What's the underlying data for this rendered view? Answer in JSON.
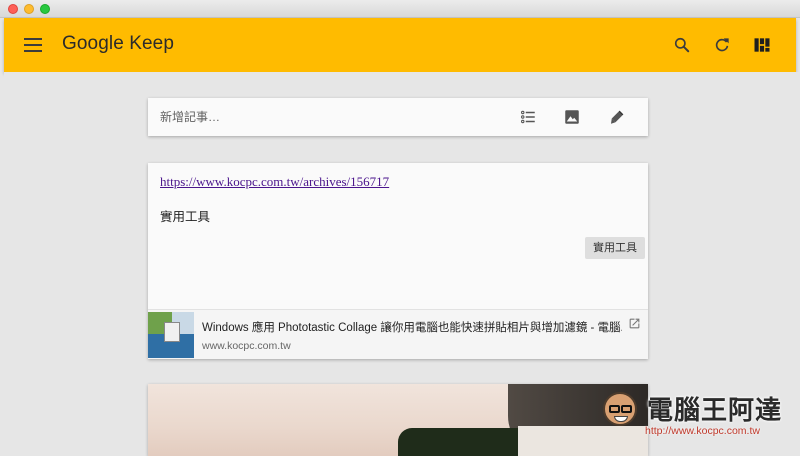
{
  "appbar": {
    "title": "Google Keep",
    "color": "#ffbb00"
  },
  "new_note": {
    "placeholder": "新增記事…"
  },
  "note": {
    "link": "https://www.kocpc.com.tw/archives/156717",
    "text": "實用工具",
    "label": "實用工具",
    "preview": {
      "title": "Windows 應用 Phototastic Collage 讓你用電腦也能快速拼貼相片與增加濾鏡 - 電腦...",
      "domain": "www.kocpc.com.tw"
    }
  },
  "watermark": {
    "name": "電腦王阿達",
    "url": "http://www.kocpc.com.tw"
  },
  "icons": {
    "menu": "menu-icon",
    "search": "search-icon",
    "refresh": "refresh-icon",
    "layout": "grid-view-icon",
    "list": "checklist-icon",
    "image": "image-icon",
    "draw": "brush-icon",
    "open": "open-in-new-icon"
  }
}
